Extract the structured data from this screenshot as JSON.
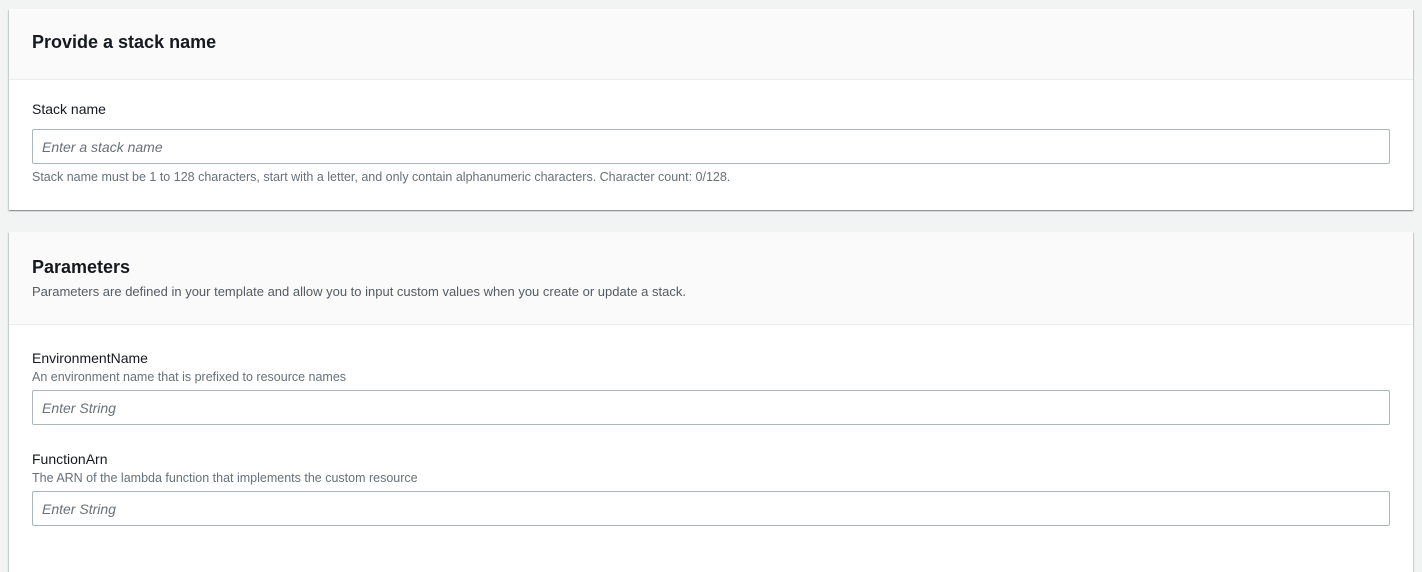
{
  "stack_section": {
    "title": "Provide a stack name",
    "field_label": "Stack name",
    "placeholder": "Enter a stack name",
    "value": "",
    "help": "Stack name must be 1 to 128 characters, start with a letter, and only contain alphanumeric characters. Character count: 0/128."
  },
  "parameters_section": {
    "title": "Parameters",
    "description": "Parameters are defined in your template and allow you to input custom values when you create or update a stack.",
    "params": [
      {
        "label": "EnvironmentName",
        "description": "An environment name that is prefixed to resource names",
        "placeholder": "Enter String"
      },
      {
        "label": "FunctionArn",
        "description": "The ARN of the lambda function that implements the custom resource",
        "placeholder": "Enter String"
      }
    ]
  }
}
